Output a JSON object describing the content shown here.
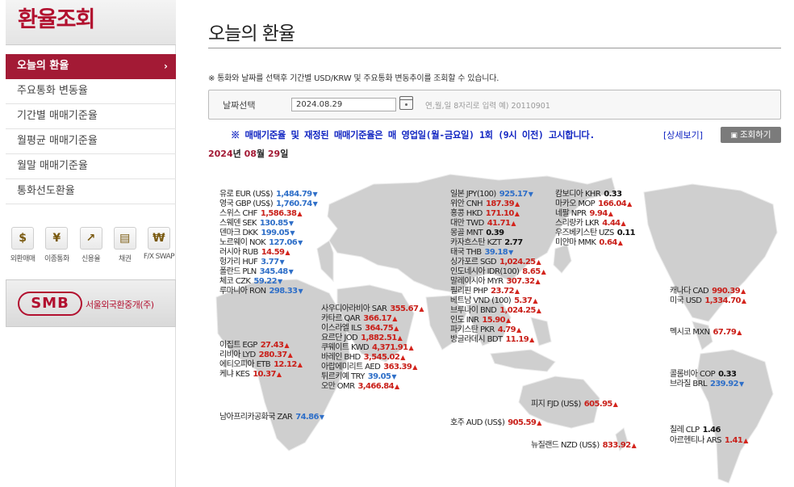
{
  "sidebar": {
    "title": "환율조회",
    "menu": [
      {
        "label": "오늘의 환율",
        "active": true
      },
      {
        "label": "주요통화 변동율"
      },
      {
        "label": "기간별 매매기준율"
      },
      {
        "label": "월평균 매매기준율"
      },
      {
        "label": "월말 매매기준율"
      },
      {
        "label": "통화선도환율"
      }
    ],
    "active_chevron": "›",
    "quick": [
      {
        "label": "외환매매",
        "icon": "coin-icon",
        "glyph": "$"
      },
      {
        "label": "이종통화",
        "icon": "currency-icon",
        "glyph": "¥"
      },
      {
        "label": "신용율",
        "icon": "chart-icon",
        "glyph": "↗"
      },
      {
        "label": "채권",
        "icon": "bond-icon",
        "glyph": "▤"
      },
      {
        "label": "F/X SWAP",
        "icon": "won-icon",
        "glyph": "₩"
      }
    ],
    "banner": {
      "logo": "SMB",
      "text": "서울외국환중개(주)"
    }
  },
  "main": {
    "title": "오늘의 환율",
    "note": "※ 통화와 날짜를 선택후 기간별 USD/KRW 및 주요통화 변동추이를 조회할 수 있습니다.",
    "date_label": "날짜선택",
    "date_value": "2024.08.29",
    "date_hint": "연,월,일 8자리로 입력 예) 20110901",
    "announce": "※ 매매기준율 및 재정된 매매기준율은 매 영업일(월-금요일) 1회 (9시 이전) 고시합니다.",
    "detail_link": "[상세보기]",
    "search_button": "조회하기",
    "date_heading": {
      "year": "2024",
      "y_suffix": "년",
      "month": "08",
      "m_suffix": "월",
      "day": "29",
      "d_suffix": "일"
    }
  },
  "colors": {
    "brand": "#a31a35",
    "up": "#c9201a",
    "down": "#2f6fc8",
    "link": "#1226c2"
  },
  "rates": [
    {
      "label": "유로 EUR (US$)",
      "value": "1,484.79",
      "dir": "down"
    },
    {
      "label": "영국 GBP (US$)",
      "value": "1,760.74",
      "dir": "down"
    },
    {
      "label": "스위스 CHF",
      "value": "1,586.38",
      "dir": "up"
    },
    {
      "label": "스웨덴 SEK",
      "value": "130.85",
      "dir": "down"
    },
    {
      "label": "덴마크 DKK",
      "value": "199.05",
      "dir": "down"
    },
    {
      "label": "노르웨이 NOK",
      "value": "127.06",
      "dir": "down"
    },
    {
      "label": "러시아 RUB",
      "value": "14.59",
      "dir": "up"
    },
    {
      "label": "헝가리 HUF",
      "value": "3.77",
      "dir": "down"
    },
    {
      "label": "폴란드 PLN",
      "value": "345.48",
      "dir": "down"
    },
    {
      "label": "체코 CZK",
      "value": "59.22",
      "dir": "down"
    },
    {
      "label": "루마니아 RON",
      "value": "298.33",
      "dir": "down"
    },
    {
      "label": "일본 JPY(100)",
      "value": "925.17",
      "dir": "down"
    },
    {
      "label": "위안 CNH",
      "value": "187.39",
      "dir": "up"
    },
    {
      "label": "홍콩 HKD",
      "value": "171.10",
      "dir": "up"
    },
    {
      "label": "대만 TWD",
      "value": "41.71",
      "dir": "up"
    },
    {
      "label": "몽골 MNT",
      "value": "0.39",
      "dir": "flat"
    },
    {
      "label": "카자흐스탄 KZT",
      "value": "2.77",
      "dir": "flat"
    },
    {
      "label": "태국 THB",
      "value": "39.18",
      "dir": "down"
    },
    {
      "label": "싱가포르 SGD",
      "value": "1,024.25",
      "dir": "up"
    },
    {
      "label": "인도네시아 IDR(100)",
      "value": "8.65",
      "dir": "up"
    },
    {
      "label": "말레이시아 MYR",
      "value": "307.32",
      "dir": "up"
    },
    {
      "label": "필리핀 PHP",
      "value": "23.72",
      "dir": "up"
    },
    {
      "label": "베트남 VND (100)",
      "value": "5.37",
      "dir": "up"
    },
    {
      "label": "브루나이 BND",
      "value": "1,024.25",
      "dir": "up"
    },
    {
      "label": "인도 INR",
      "value": "15.90",
      "dir": "up"
    },
    {
      "label": "파키스탄 PKR",
      "value": "4.79",
      "dir": "up"
    },
    {
      "label": "방글라데시 BDT",
      "value": "11.19",
      "dir": "up"
    },
    {
      "label": "캄보디아 KHR",
      "value": "0.33",
      "dir": "flat"
    },
    {
      "label": "마카오 MOP",
      "value": "166.04",
      "dir": "up"
    },
    {
      "label": "네팔 NPR",
      "value": "9.94",
      "dir": "up"
    },
    {
      "label": "스리랑카 LKR",
      "value": "4.44",
      "dir": "up"
    },
    {
      "label": "우즈베키스탄 UZS",
      "value": "0.11",
      "dir": "flat"
    },
    {
      "label": "미얀마 MMK",
      "value": "0.64",
      "dir": "up"
    },
    {
      "label": "사우디아라비아 SAR",
      "value": "355.67",
      "dir": "up"
    },
    {
      "label": "카타르 QAR",
      "value": "366.17",
      "dir": "up"
    },
    {
      "label": "이스라엘 ILS",
      "value": "364.75",
      "dir": "up"
    },
    {
      "label": "요르단 JOD",
      "value": "1,882.51",
      "dir": "up"
    },
    {
      "label": "쿠웨이트 KWD",
      "value": "4,371.91",
      "dir": "up"
    },
    {
      "label": "바레인 BHD",
      "value": "3,545.02",
      "dir": "up"
    },
    {
      "label": "아랍에미리트 AED",
      "value": "363.39",
      "dir": "up"
    },
    {
      "label": "튀르키예 TRY",
      "value": "39.05",
      "dir": "down"
    },
    {
      "label": "오만 OMR",
      "value": "3,466.84",
      "dir": "up"
    },
    {
      "label": "이집트 EGP",
      "value": "27.43",
      "dir": "up"
    },
    {
      "label": "리비아 LYD",
      "value": "280.37",
      "dir": "up"
    },
    {
      "label": "에티오피아 ETB",
      "value": "12.12",
      "dir": "up"
    },
    {
      "label": "케냐 KES",
      "value": "10.37",
      "dir": "up"
    },
    {
      "label": "남아프리카공화국 ZAR",
      "value": "74.86",
      "dir": "down"
    },
    {
      "label": "캐나다 CAD",
      "value": "990.39",
      "dir": "up"
    },
    {
      "label": "미국 USD",
      "value": "1,334.70",
      "dir": "up"
    },
    {
      "label": "멕시코 MXN",
      "value": "67.79",
      "dir": "up"
    },
    {
      "label": "콜롬비아 COP",
      "value": "0.33",
      "dir": "flat"
    },
    {
      "label": "브라질 BRL",
      "value": "239.92",
      "dir": "down"
    },
    {
      "label": "칠레 CLP",
      "value": "1.46",
      "dir": "flat"
    },
    {
      "label": "아르헨티나 ARS",
      "value": "1.41",
      "dir": "up"
    },
    {
      "label": "피지 FJD (US$)",
      "value": "605.95",
      "dir": "up"
    },
    {
      "label": "호주 AUD (US$)",
      "value": "905.59",
      "dir": "up"
    },
    {
      "label": "뉴질랜드 NZD (US$)",
      "value": "833.92",
      "dir": "up"
    }
  ]
}
